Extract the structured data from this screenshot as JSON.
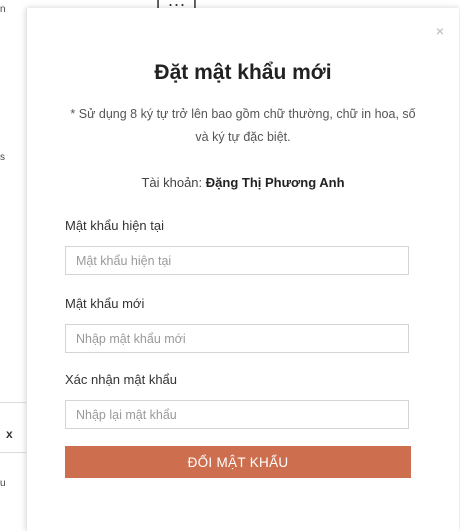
{
  "background": {
    "top_fragment": "[ ... ]",
    "left_fragment_1": "n",
    "left_fragment_2": "s",
    "left_x": "x",
    "left_fragment_3": "u"
  },
  "modal": {
    "close_icon": "×",
    "title": "Đặt mật khẩu mới",
    "note": "* Sử dụng 8 ký tự trở lên bao gồm chữ thường, chữ in hoa, số và ký tự đặc biệt.",
    "account_label": "Tài khoản:",
    "account_name": "Đặng Thị Phương Anh",
    "fields": [
      {
        "label": "Mật khẩu hiện tại",
        "placeholder": "Mật khẩu hiện tại",
        "value": ""
      },
      {
        "label": "Mật khẩu mới",
        "placeholder": "Nhập mật khẩu mới",
        "value": ""
      },
      {
        "label": "Xác nhận mật khẩu",
        "placeholder": "Nhập lại mật khẩu",
        "value": ""
      }
    ],
    "submit_label": "ĐỔI MẬT KHẨU"
  },
  "colors": {
    "accent": "#cd6f4f",
    "title": "#222222",
    "border": "#d4d4d4",
    "placeholder": "#9a9a9a"
  },
  "icons": {
    "close": "close-icon"
  }
}
